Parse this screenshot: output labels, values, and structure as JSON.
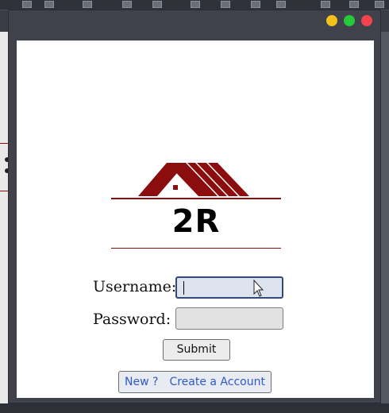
{
  "window": {
    "controls": [
      "minimize",
      "maximize",
      "close"
    ]
  },
  "logo": {
    "text": "2R",
    "icon": "house-roof-icon",
    "color": "#8c0d0d"
  },
  "form": {
    "username_label": "Username:",
    "username_value": "",
    "password_label": "Password:",
    "password_value": "",
    "submit_label": "Submit",
    "new_label": "New ?",
    "create_label": "Create a Account"
  },
  "colors": {
    "link": "#2f59c8",
    "focus_border": "#32497a"
  }
}
